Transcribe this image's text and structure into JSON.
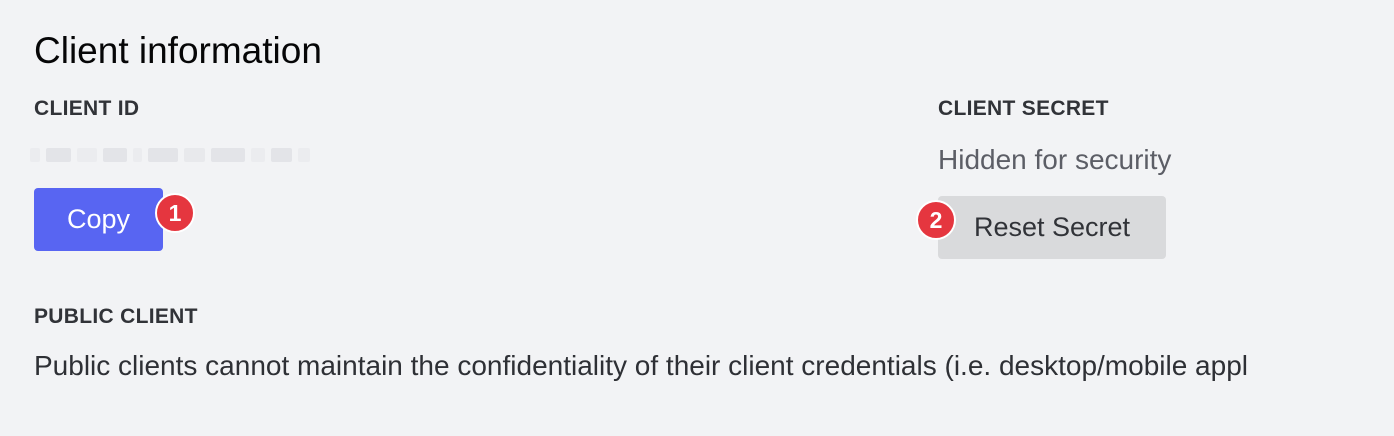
{
  "section": {
    "title": "Client information"
  },
  "client_id": {
    "label": "CLIENT ID",
    "value_redacted": true,
    "copy_button": "Copy"
  },
  "client_secret": {
    "label": "CLIENT SECRET",
    "value": "Hidden for security",
    "reset_button": "Reset Secret"
  },
  "public_client": {
    "label": "PUBLIC CLIENT",
    "description": "Public clients cannot maintain the confidentiality of their client credentials (i.e. desktop/mobile appl"
  },
  "step_markers": {
    "first": "1",
    "second": "2"
  },
  "colors": {
    "primary_button": "#5865f2",
    "secondary_button": "#d9dadc",
    "step_marker": "#e5363f",
    "background": "#f2f3f5"
  }
}
